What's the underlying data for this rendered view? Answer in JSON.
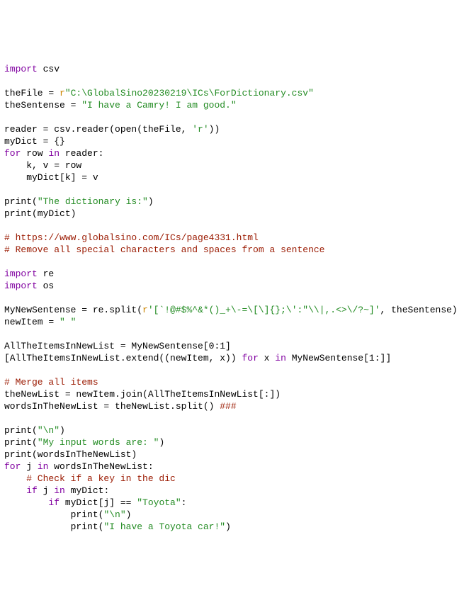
{
  "l1_import": "import",
  "l1_csv": " csv",
  "blank": "",
  "l3a": "theFile = ",
  "l3r": "r",
  "l3s": "\"C:\\GlobalSino20230219\\ICs\\ForDictionary.csv\"",
  "l4a": "theSentense = ",
  "l4s": "\"I have a Camry! I am good.\"",
  "l6": "reader = csv.reader(open(theFile, ",
  "l6s": "'r'",
  "l6b": "))",
  "l7": "myDict = {}",
  "l8for": "for",
  "l8a": " row ",
  "l8in": "in",
  "l8b": " reader:",
  "l9": "    k, v = row",
  "l10": "    myDict[k] = v",
  "l12a": "print(",
  "l12s": "\"The dictionary is:\"",
  "l12b": ")",
  "l13": "print(myDict)",
  "l15": "# https://www.globalsino.com/ICs/page4331.html",
  "l16": "# Remove all special characters and spaces from a sentence",
  "l18_import": "import",
  "l18_re": " re",
  "l19_import": "import",
  "l19_os": " os",
  "l21a": "MyNewSentense = re.split(",
  "l21r": "r",
  "l21s": "'[`!@#$%^&*()_+\\-=\\[\\]{};\\':\"\\\\|,.<>\\/?~]'",
  "l21b": ", theSentense)",
  "l22a": "newItem = ",
  "l22s": "\" \"",
  "l24": "AllTheItemsInNewList = MyNewSentense[0:1]",
  "l25a": "[AllTheItemsInNewList.extend((newItem, x)) ",
  "l25for": "for",
  "l25b": " x ",
  "l25in": "in",
  "l25c": " MyNewSentense[1:]]",
  "l27": "# Merge all items",
  "l28": "theNewList = newItem.join(AllTheItemsInNewList[:])",
  "l29a": "wordsInTheNewList = theNewList.split() ",
  "l29c": "###",
  "l31a": "print(",
  "l31s": "\"\\n\"",
  "l31b": ")",
  "l32a": "print(",
  "l32s": "\"My input words are: \"",
  "l32b": ")",
  "l33": "print(wordsInTheNewList)",
  "l34for": "for",
  "l34a": " j ",
  "l34in": "in",
  "l34b": " wordsInTheNewList:",
  "l35": "    # Check if a key in the dic",
  "l36a": "    ",
  "l36if": "if",
  "l36b": " j ",
  "l36in": "in",
  "l36c": " myDict:",
  "l37a": "        ",
  "l37if": "if",
  "l37b": " myDict[j] == ",
  "l37s": "\"Toyota\"",
  "l37c": ":",
  "l38a": "            print(",
  "l38s": "\"\\n\"",
  "l38b": ")",
  "l39a": "            print(",
  "l39s": "\"I have a Toyota car!\"",
  "l39b": ")"
}
